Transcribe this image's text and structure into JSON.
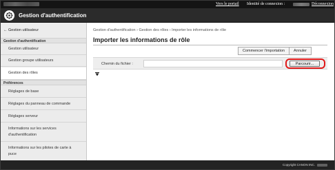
{
  "topbar": {
    "portal_link": "Vers le portail",
    "identity_label": "Identité de connexion :",
    "logout_link": "Déconnexion"
  },
  "header": {
    "title": "Gestion d'authentification",
    "logo_icon": "gear-seal-icon"
  },
  "sidebar": {
    "back_link": "← Gestion utilisateur",
    "section_auth": "Gestion d'authentification",
    "items_auth": [
      {
        "label": "Gestion utilisateur"
      },
      {
        "label": "Gestion groupe utilisateurs"
      },
      {
        "label": "Gestion des rôles"
      }
    ],
    "section_prefs": "Préférences",
    "items_prefs": [
      {
        "label": "Réglages de base"
      },
      {
        "label": "Réglages du panneau de commande"
      },
      {
        "label": "Réglages serveur"
      },
      {
        "label": "Informations sur les services\nd'authentification"
      },
      {
        "label": "Informations sur les pilotes de carte à\npuce"
      }
    ]
  },
  "main": {
    "breadcrumb": "Gestion d'authentification › Gestion des rôles › Importer les informations de rôle",
    "page_title": "Importer les informations de rôle",
    "start_import_button": "Commencer l'importation",
    "cancel_button": "Annuler",
    "file_path_label": "Chemin du fichier :",
    "file_path_value": "",
    "browse_button": "Parcourir..."
  },
  "footer": {
    "copyright": "Copyright CANON INC."
  },
  "colors": {
    "highlight": "#e01919",
    "header_bg": "#2b2b2b",
    "topbar_bg": "#141414"
  }
}
